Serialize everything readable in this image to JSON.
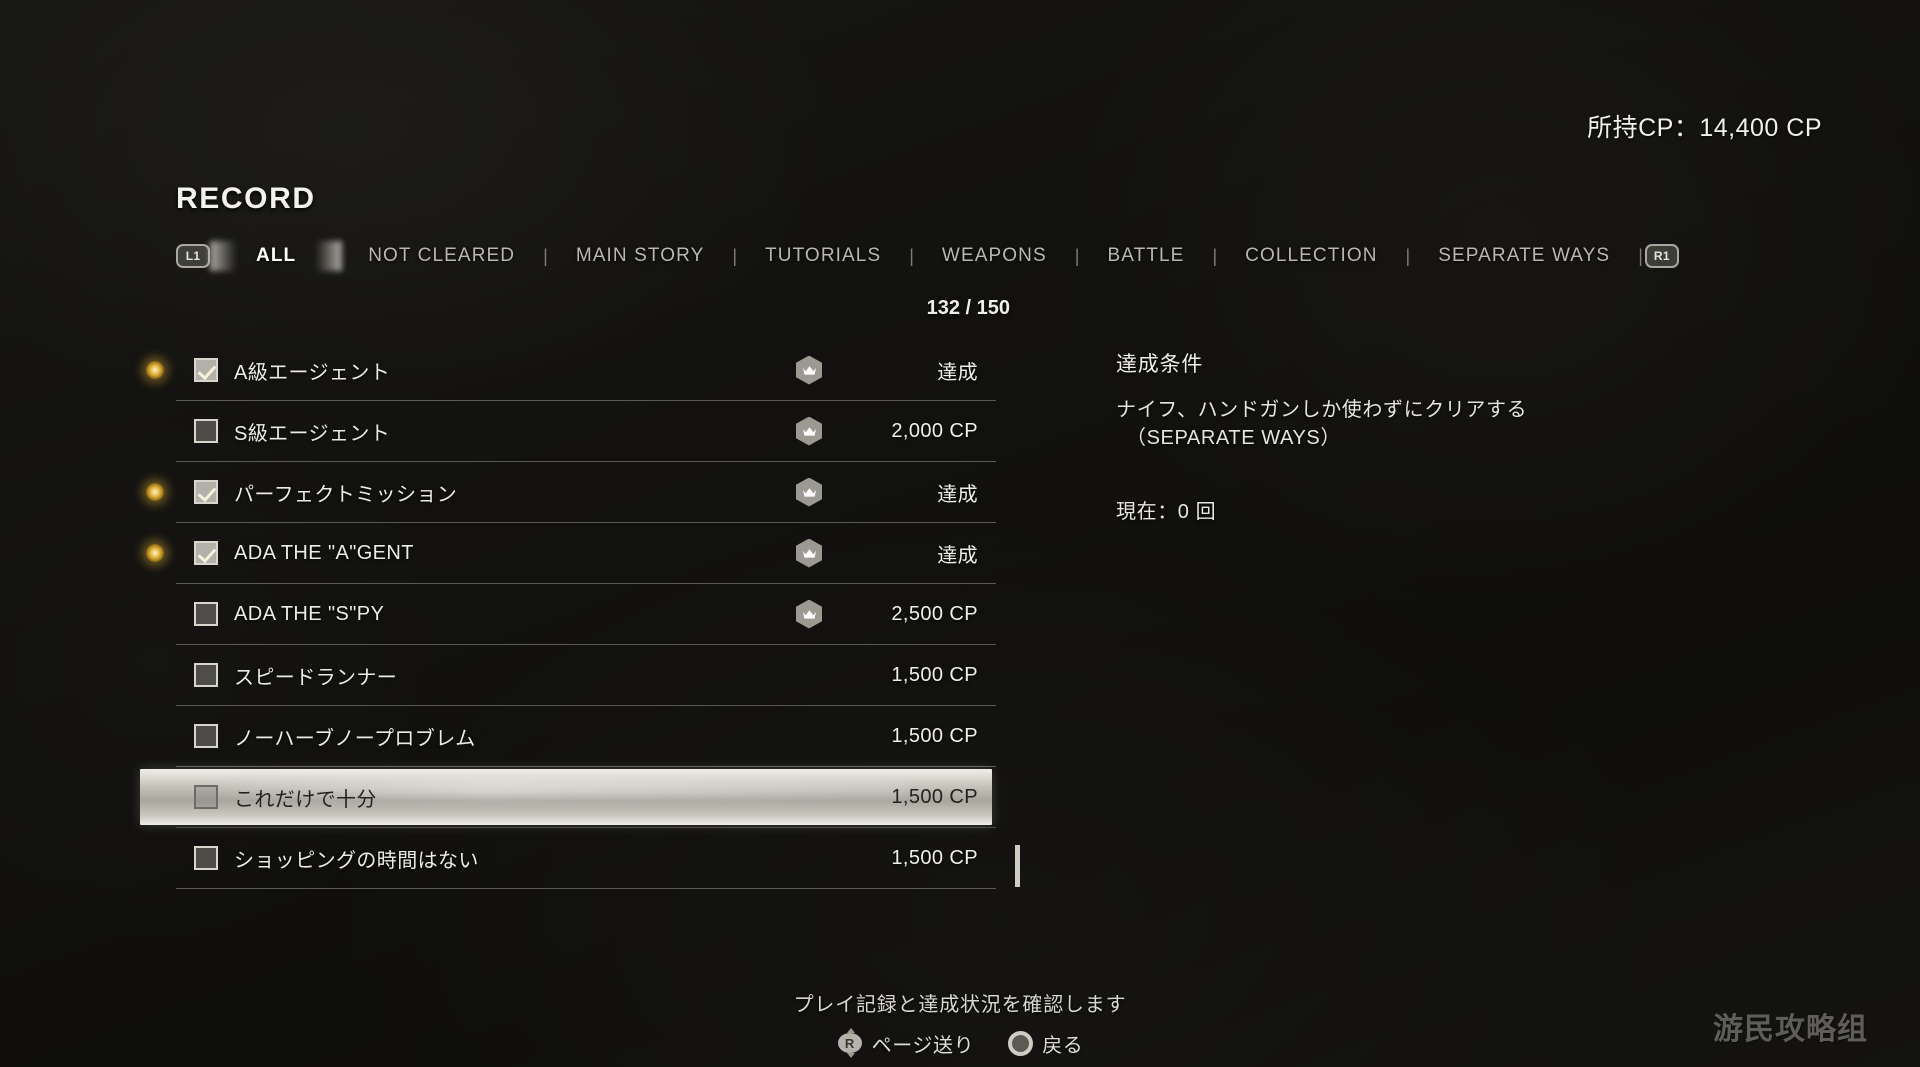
{
  "currency": {
    "label": "所持CP：14,400 CP"
  },
  "page": {
    "title": "RECORD"
  },
  "tabs": {
    "left_bumper": "L1",
    "right_bumper": "R1",
    "divider": "|",
    "items": [
      {
        "label": "ALL",
        "active": true
      },
      {
        "label": "NOT CLEARED",
        "active": false
      },
      {
        "label": "MAIN STORY",
        "active": false
      },
      {
        "label": "TUTORIALS",
        "active": false
      },
      {
        "label": "WEAPONS",
        "active": false
      },
      {
        "label": "BATTLE",
        "active": false
      },
      {
        "label": "COLLECTION",
        "active": false
      },
      {
        "label": "SEPARATE WAYS",
        "active": false
      }
    ]
  },
  "list": {
    "count": "132 / 150",
    "rows": [
      {
        "title": "A級エージェント",
        "value": "達成",
        "checked": true,
        "marker": true,
        "crown": true,
        "selected": false
      },
      {
        "title": "S級エージェント",
        "value": "2,000 CP",
        "checked": false,
        "marker": false,
        "crown": true,
        "selected": false
      },
      {
        "title": "パーフェクトミッション",
        "value": "達成",
        "checked": true,
        "marker": true,
        "crown": true,
        "selected": false
      },
      {
        "title": "ADA THE \"A\"GENT",
        "value": "達成",
        "checked": true,
        "marker": true,
        "crown": true,
        "selected": false
      },
      {
        "title": "ADA THE \"S\"PY",
        "value": "2,500 CP",
        "checked": false,
        "marker": false,
        "crown": true,
        "selected": false
      },
      {
        "title": "スピードランナー",
        "value": "1,500 CP",
        "checked": false,
        "marker": false,
        "crown": false,
        "selected": false
      },
      {
        "title": "ノーハーブノープロブレム",
        "value": "1,500 CP",
        "checked": false,
        "marker": false,
        "crown": false,
        "selected": false
      },
      {
        "title": "これだけで十分",
        "value": "1,500 CP",
        "checked": false,
        "marker": false,
        "crown": false,
        "selected": true
      },
      {
        "title": "ショッピングの時間はない",
        "value": "1,500 CP",
        "checked": false,
        "marker": false,
        "crown": false,
        "selected": false
      }
    ]
  },
  "detail": {
    "heading": "達成条件",
    "condition_line1": "ナイフ、ハンドガンしか使わずにクリアする",
    "condition_line2": "（SEPARATE WAYS）",
    "progress": "現在：0 回"
  },
  "footer": {
    "hint": "プレイ記録と達成状況を確認します",
    "buttons": [
      {
        "icon": "right-stick-icon",
        "glyph": "R",
        "label": "ページ送り"
      },
      {
        "icon": "circle-button-icon",
        "glyph": "",
        "label": "戻る"
      }
    ]
  },
  "watermark": {
    "text": "游民攻略组"
  },
  "colors": {
    "accent_gold": "#e0b23c",
    "text_primary": "#f2f0ea",
    "text_muted": "#b9b7b0",
    "selection": "#cfccc4",
    "background": "#1b1b19"
  }
}
